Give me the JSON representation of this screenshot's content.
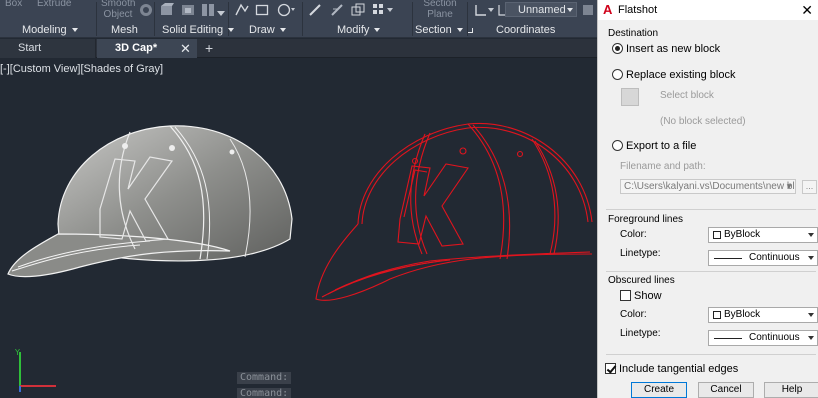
{
  "ribbon": {
    "top_labels": {
      "box": "Box",
      "extrude": "Extrude",
      "smooth_object": "Smooth Object",
      "section_plane": "Section Plane",
      "view_name": "Unnamed"
    },
    "panels": [
      {
        "label": "Modeling"
      },
      {
        "label": "Mesh"
      },
      {
        "label": "Solid Editing"
      },
      {
        "label": "Draw"
      },
      {
        "label": "Modify"
      },
      {
        "label": "Section"
      },
      {
        "label": "Coordinates"
      }
    ]
  },
  "tabs": {
    "start": "Start",
    "active": "3D Cap*",
    "close": "✕",
    "add": "+"
  },
  "viewport": {
    "controls": "[-][Custom View][Shades of Gray]",
    "command_lines": [
      "Command:",
      "Command:"
    ]
  },
  "dialog": {
    "title": "Flatshot",
    "close": "✕",
    "destination": {
      "label": "Destination",
      "insert_new": "Insert as new block",
      "replace_existing": "Replace existing block",
      "select_block": "Select block",
      "no_block": "(No block selected)",
      "export_file": "Export to a file",
      "filename_label": "Filename and path:",
      "filename_value": "C:\\Users\\kalyani.vs\\Documents\\new block.dwg",
      "browse": "..."
    },
    "foreground": {
      "label": "Foreground lines",
      "color_label": "Color:",
      "color_value": "ByBlock",
      "linetype_label": "Linetype:",
      "linetype_value": "Continuous"
    },
    "obscured": {
      "label": "Obscured lines",
      "show_label": "Show",
      "show_checked": false,
      "color_label": "Color:",
      "color_value": "ByBlock",
      "linetype_label": "Linetype:",
      "linetype_value": "Continuous"
    },
    "include_tangential": {
      "label": "Include tangential edges",
      "checked": true
    },
    "buttons": {
      "create": "Create",
      "cancel": "Cancel",
      "help": "Help"
    }
  },
  "colors": {
    "background": "#222933",
    "ribbon": "#3b4453",
    "flat_lines": "#e0141e",
    "accent": "#0078d7"
  }
}
